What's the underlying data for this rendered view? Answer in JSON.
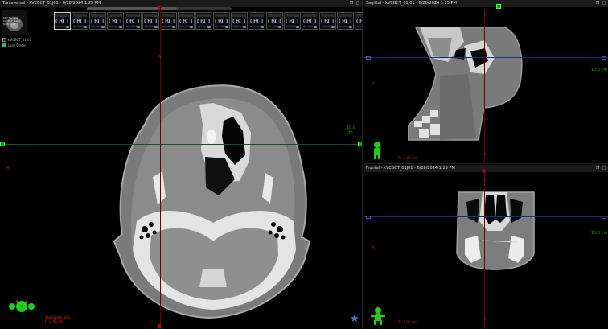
{
  "transverse": {
    "title": "Transversal - kVCBCT_01J01 - 6/28/2024 1:25 PM",
    "patient_lines": [
      "CBCT image",
      "kVCBCT_01J01",
      "6/28/2024"
    ],
    "options": [
      {
        "label": "kVCBCT_01J01",
        "checked": false
      },
      {
        "label": "User Origin",
        "checked": true
      }
    ],
    "thumbnails": [
      {
        "label": "CBCT",
        "date": "6/28/2024"
      },
      {
        "label": "CBCT",
        "date": "7/1/2024"
      },
      {
        "label": "CBCT",
        "date": "7/2/2024"
      },
      {
        "label": "CBCT",
        "date": "7/3/2024"
      },
      {
        "label": "CBCT",
        "date": "7/5/2024"
      },
      {
        "label": "CBCT",
        "date": "7/8/2024"
      },
      {
        "label": "CBCT",
        "date": "7/9/2024"
      },
      {
        "label": "CBCT",
        "date": "7/10/2024"
      },
      {
        "label": "CBCT",
        "date": "7/11/2024"
      },
      {
        "label": "CBCT",
        "date": "7/12/2024"
      },
      {
        "label": "CBCT",
        "date": "7/15/2024"
      },
      {
        "label": "CBCT",
        "date": "7/16/2024"
      },
      {
        "label": "CBCT",
        "date": "7/17/2024"
      },
      {
        "label": "CBCT",
        "date": "7/18/2024"
      },
      {
        "label": "CBCT",
        "date": "7/19/2024"
      },
      {
        "label": "CBCT",
        "date": "7/22/2024"
      },
      {
        "label": "CBCT",
        "date": "7/23/2024"
      },
      {
        "label": "CBCT",
        "date": "7/24/2024"
      }
    ],
    "scale": "10.0 cm",
    "info_lines": [
      "Standard/L:W:S",
      "F: -2.95 cm"
    ],
    "orient_left": "R",
    "orient_top": "A"
  },
  "sagittal": {
    "title": "Sagittal - kVCBCT_01J01 - 6/28/2024 1:25 PM",
    "scale": "10.0 cm",
    "info": "R: -1.00 cm",
    "orient_top": "H",
    "orient_left": "P",
    "orient_bottom": "F"
  },
  "frontal": {
    "title": "Frontal - kVCBCT_01J01 - 6/28/2024 1:25 PM",
    "scale": "10.0 cm",
    "info": "P: -1.00 cm",
    "orient_top": "H",
    "orient_left": "R",
    "orient_bottom": "F"
  },
  "colors": {
    "crosshair_v": "#6b0000",
    "crosshair_h": "#1f4d1f",
    "orientation_icon": "#18d318",
    "star": "#3d84d9"
  },
  "icons": [
    "human-figure-icon",
    "dose-balls-icon",
    "star-icon",
    "window-control-icons"
  ]
}
